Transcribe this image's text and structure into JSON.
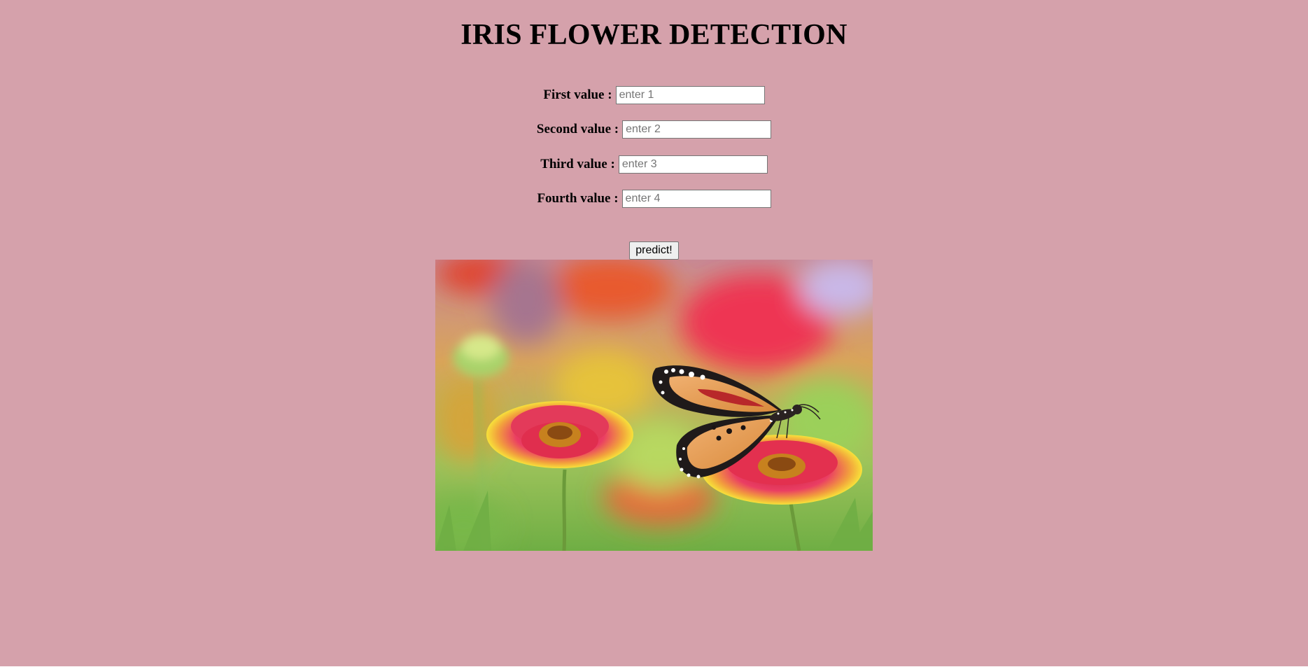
{
  "page": {
    "title": "IRIS FLOWER DETECTION",
    "background_color": "#d5a1ab"
  },
  "form": {
    "fields": [
      {
        "label": "First value :",
        "placeholder": "enter 1",
        "value": ""
      },
      {
        "label": "Second value :",
        "placeholder": "enter 2",
        "value": ""
      },
      {
        "label": "Third value :",
        "placeholder": "enter 3",
        "value": ""
      },
      {
        "label": "Fourth value :",
        "placeholder": "enter 4",
        "value": ""
      }
    ],
    "submit_label": "predict!"
  },
  "image": {
    "subject": "butterfly-on-flowers-photo",
    "accent_colors": [
      "#e9354f",
      "#f2b844",
      "#e89a4f",
      "#7cba4a"
    ]
  }
}
